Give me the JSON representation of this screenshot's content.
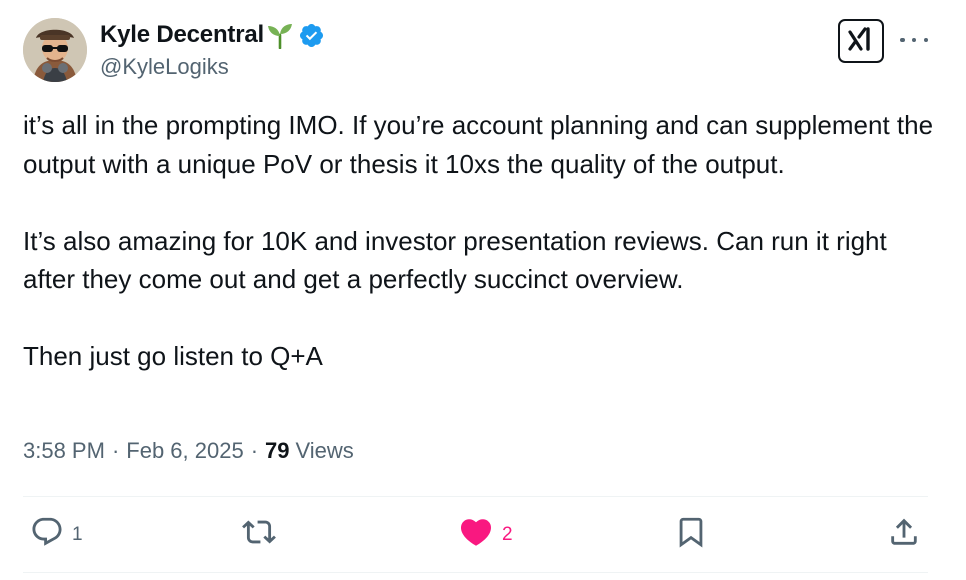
{
  "author": {
    "display_name": "Kyle Decentral",
    "handle": "@KyleLogiks",
    "emoji_icon": "seedling-icon",
    "verified_icon": "verified-badge-icon"
  },
  "header": {
    "grok_icon": "grok-icon",
    "more_icon": "more-icon"
  },
  "tweet": {
    "paragraphs": [
      "it’s all in the prompting IMO. If you’re account planning and can supplement the output with a unique PoV or thesis it 10xs the quality of the output.",
      "It’s also amazing for 10K and investor presentation reviews. Can run it right after they come out and get a perfectly succinct overview.",
      "Then just go listen to Q+A"
    ],
    "time": "3:58 PM",
    "date": "Feb 6, 2025",
    "separator": "·",
    "views_count": "79",
    "views_label": "Views"
  },
  "actions": {
    "reply": {
      "icon": "reply-icon",
      "count": "1"
    },
    "retweet": {
      "icon": "retweet-icon",
      "count": ""
    },
    "like": {
      "icon": "heart-icon",
      "count": "2",
      "active": true
    },
    "bookmark": {
      "icon": "bookmark-icon",
      "count": ""
    },
    "share": {
      "icon": "share-icon",
      "count": ""
    }
  },
  "colors": {
    "text_primary": "#0f1419",
    "text_secondary": "#536471",
    "verified_blue": "#1d9bf0",
    "like_pink": "#f91880",
    "divider": "#eff3f4"
  }
}
